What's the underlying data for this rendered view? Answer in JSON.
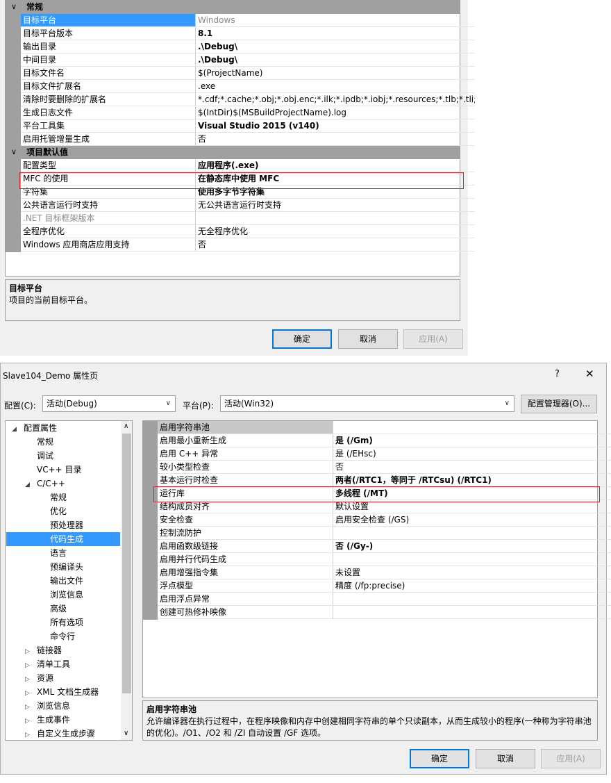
{
  "top_panel": {
    "categories": [
      {
        "label": "常规",
        "chevron": "∨"
      },
      {
        "label": "项目默认值",
        "chevron": "∨"
      }
    ],
    "general_rows": [
      {
        "name": "目标平台",
        "value": "Windows",
        "selected": true,
        "gray_value": true
      },
      {
        "name": "目标平台版本",
        "value": "8.1",
        "bold": true
      },
      {
        "name": "输出目录",
        "value": ".\\Debug\\",
        "bold": true
      },
      {
        "name": "中间目录",
        "value": ".\\Debug\\",
        "bold": true
      },
      {
        "name": "目标文件名",
        "value": "$(ProjectName)"
      },
      {
        "name": "目标文件扩展名",
        "value": ".exe"
      },
      {
        "name": "清除时要删除的扩展名",
        "value": "*.cdf;*.cache;*.obj;*.obj.enc;*.ilk;*.ipdb;*.iobj;*.resources;*.tlb;*.tli;*.t"
      },
      {
        "name": "生成日志文件",
        "value": "$(IntDir)$(MSBuildProjectName).log"
      },
      {
        "name": "平台工具集",
        "value": "Visual Studio 2015 (v140)",
        "bold": true
      },
      {
        "name": "启用托管增量生成",
        "value": "否"
      }
    ],
    "default_rows": [
      {
        "name": "配置类型",
        "value": "应用程序(.exe)",
        "bold": true
      },
      {
        "name": "MFC 的使用",
        "value": "在静态库中使用 MFC",
        "bold": true
      },
      {
        "name": "字符集",
        "value": "使用多字节字符集",
        "bold": true
      },
      {
        "name": "公共语言运行时支持",
        "value": "无公共语言运行时支持"
      },
      {
        "name": ".NET 目标框架版本",
        "value": "",
        "gray_name": true
      },
      {
        "name": "全程序优化",
        "value": "无全程序优化"
      },
      {
        "name": "Windows 应用商店应用支持",
        "value": "否"
      }
    ],
    "desc_title": "目标平台",
    "desc_text": "项目的当前目标平台。",
    "ok_label": "确定",
    "cancel_label": "取消",
    "apply_label": "应用(A)"
  },
  "dialog": {
    "title": "Slave104_Demo 属性页",
    "help_label": "?",
    "close_label": "✕",
    "config_label": "配置(C):",
    "config_value": "活动(Debug)",
    "platform_label": "平台(P):",
    "platform_value": "活动(Win32)",
    "config_manager_label": "配置管理器(O)...",
    "tree": [
      {
        "label": "配置属性",
        "glyph": "◢",
        "level": 0
      },
      {
        "label": "常规",
        "glyph": "",
        "level": 1
      },
      {
        "label": "调试",
        "glyph": "",
        "level": 1
      },
      {
        "label": "VC++ 目录",
        "glyph": "",
        "level": 1
      },
      {
        "label": "C/C++",
        "glyph": "◢",
        "level": 1
      },
      {
        "label": "常规",
        "glyph": "",
        "level": 2
      },
      {
        "label": "优化",
        "glyph": "",
        "level": 2
      },
      {
        "label": "预处理器",
        "glyph": "",
        "level": 2
      },
      {
        "label": "代码生成",
        "glyph": "",
        "level": 2,
        "selected": true
      },
      {
        "label": "语言",
        "glyph": "",
        "level": 2
      },
      {
        "label": "预编译头",
        "glyph": "",
        "level": 2
      },
      {
        "label": "输出文件",
        "glyph": "",
        "level": 2
      },
      {
        "label": "浏览信息",
        "glyph": "",
        "level": 2
      },
      {
        "label": "高级",
        "glyph": "",
        "level": 2
      },
      {
        "label": "所有选项",
        "glyph": "",
        "level": 2
      },
      {
        "label": "命令行",
        "glyph": "",
        "level": 2
      },
      {
        "label": "链接器",
        "glyph": "▷",
        "level": 1
      },
      {
        "label": "清单工具",
        "glyph": "▷",
        "level": 1
      },
      {
        "label": "资源",
        "glyph": "▷",
        "level": 1
      },
      {
        "label": "XML 文档生成器",
        "glyph": "▷",
        "level": 1
      },
      {
        "label": "浏览信息",
        "glyph": "▷",
        "level": 1
      },
      {
        "label": "生成事件",
        "glyph": "▷",
        "level": 1
      },
      {
        "label": "自定义生成步骤",
        "glyph": "▷",
        "level": 1
      }
    ],
    "props": [
      {
        "name": "启用字符串池",
        "value": "",
        "selected_gray": true
      },
      {
        "name": "启用最小重新生成",
        "value": "是 (/Gm)",
        "bold": true
      },
      {
        "name": "启用 C++ 异常",
        "value": "是 (/EHsc)"
      },
      {
        "name": "较小类型检查",
        "value": "否"
      },
      {
        "name": "基本运行时检查",
        "value": "两者(/RTC1，等同于 /RTCsu) (/RTC1)",
        "bold": true
      },
      {
        "name": "运行库",
        "value": "多线程 (/MT)",
        "bold": true
      },
      {
        "name": "结构成员对齐",
        "value": "默认设置"
      },
      {
        "name": "安全检查",
        "value": "启用安全检查 (/GS)"
      },
      {
        "name": "控制流防护",
        "value": ""
      },
      {
        "name": "启用函数级链接",
        "value": "否 (/Gy-)",
        "bold": true
      },
      {
        "name": "启用并行代码生成",
        "value": ""
      },
      {
        "name": "启用增强指令集",
        "value": "未设置"
      },
      {
        "name": "浮点模型",
        "value": "精度 (/fp:precise)"
      },
      {
        "name": "启用浮点异常",
        "value": ""
      },
      {
        "name": "创建可热修补映像",
        "value": ""
      }
    ],
    "desc_title": "启用字符串池",
    "desc_text": "允许编译器在执行过程中，在程序映像和内存中创建相同字符串的单个只读副本，从而生成较小的程序(一种称为字符串池的优化)。/O1、/O2 和 /ZI 自动设置 /GF 选项。",
    "ok_label": "确定",
    "cancel_label": "取消",
    "apply_label": "应用(A)"
  }
}
